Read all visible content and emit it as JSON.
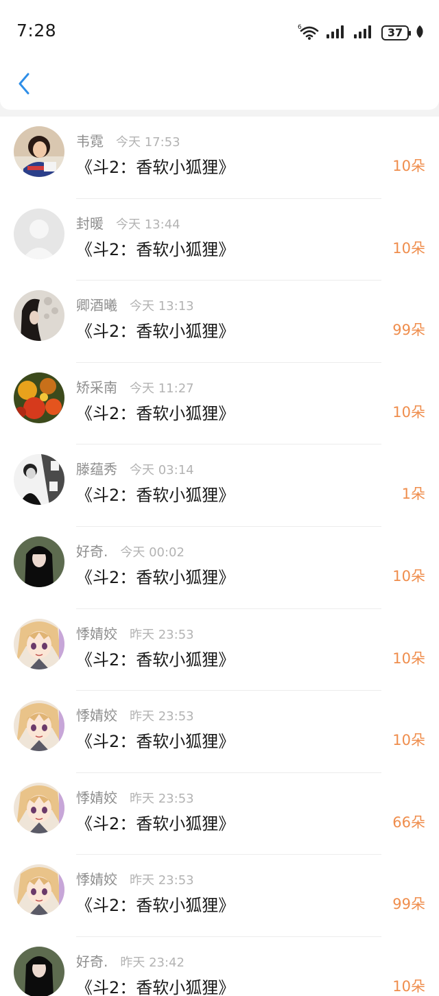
{
  "status_bar": {
    "time": "7:28",
    "battery": "37"
  },
  "colors": {
    "accent": "#ef8d4c",
    "back_arrow": "#2e8ee8",
    "name_gray": "#8e8e8e",
    "time_gray": "#b3b3b3"
  },
  "icons": {
    "back": "chevron-left-icon",
    "wifi": "wifi-6-icon",
    "signal": "cell-signal-icon",
    "battery": "battery-icon",
    "leaf": "leaf-icon"
  },
  "records": [
    {
      "name": "韦霓",
      "time": "今天 17:53",
      "title": "《斗2：香软小狐狸》",
      "amount": "10朵",
      "avatar": "avatar-girl-photo"
    },
    {
      "name": "封暖",
      "time": "今天 13:44",
      "title": "《斗2：香软小狐狸》",
      "amount": "10朵",
      "avatar": "avatar-default"
    },
    {
      "name": "卿酒曦",
      "time": "今天 13:13",
      "title": "《斗2：香软小狐狸》",
      "amount": "99朵",
      "avatar": "avatar-dark-hair"
    },
    {
      "name": "矫采南",
      "time": "今天 11:27",
      "title": "《斗2：香软小狐狸》",
      "amount": "10朵",
      "avatar": "avatar-autumn-leaves"
    },
    {
      "name": "滕蕴秀",
      "time": "今天 03:14",
      "title": "《斗2：香软小狐狸》",
      "amount": "1朵",
      "avatar": "avatar-bw-boy"
    },
    {
      "name": "好奇.",
      "time": "今天 00:02",
      "title": "《斗2：香软小狐狸》",
      "amount": "10朵",
      "avatar": "avatar-long-black-hair"
    },
    {
      "name": "悸婧姣",
      "time": "昨天 23:53",
      "title": "《斗2：香软小狐狸》",
      "amount": "10朵",
      "avatar": "avatar-anime-girl"
    },
    {
      "name": "悸婧姣",
      "time": "昨天 23:53",
      "title": "《斗2：香软小狐狸》",
      "amount": "10朵",
      "avatar": "avatar-anime-girl"
    },
    {
      "name": "悸婧姣",
      "time": "昨天 23:53",
      "title": "《斗2：香软小狐狸》",
      "amount": "66朵",
      "avatar": "avatar-anime-girl"
    },
    {
      "name": "悸婧姣",
      "time": "昨天 23:53",
      "title": "《斗2：香软小狐狸》",
      "amount": "99朵",
      "avatar": "avatar-anime-girl"
    },
    {
      "name": "好奇.",
      "time": "昨天 23:42",
      "title": "《斗2：香软小狐狸》",
      "amount": "10朵",
      "avatar": "avatar-long-black-hair"
    }
  ]
}
